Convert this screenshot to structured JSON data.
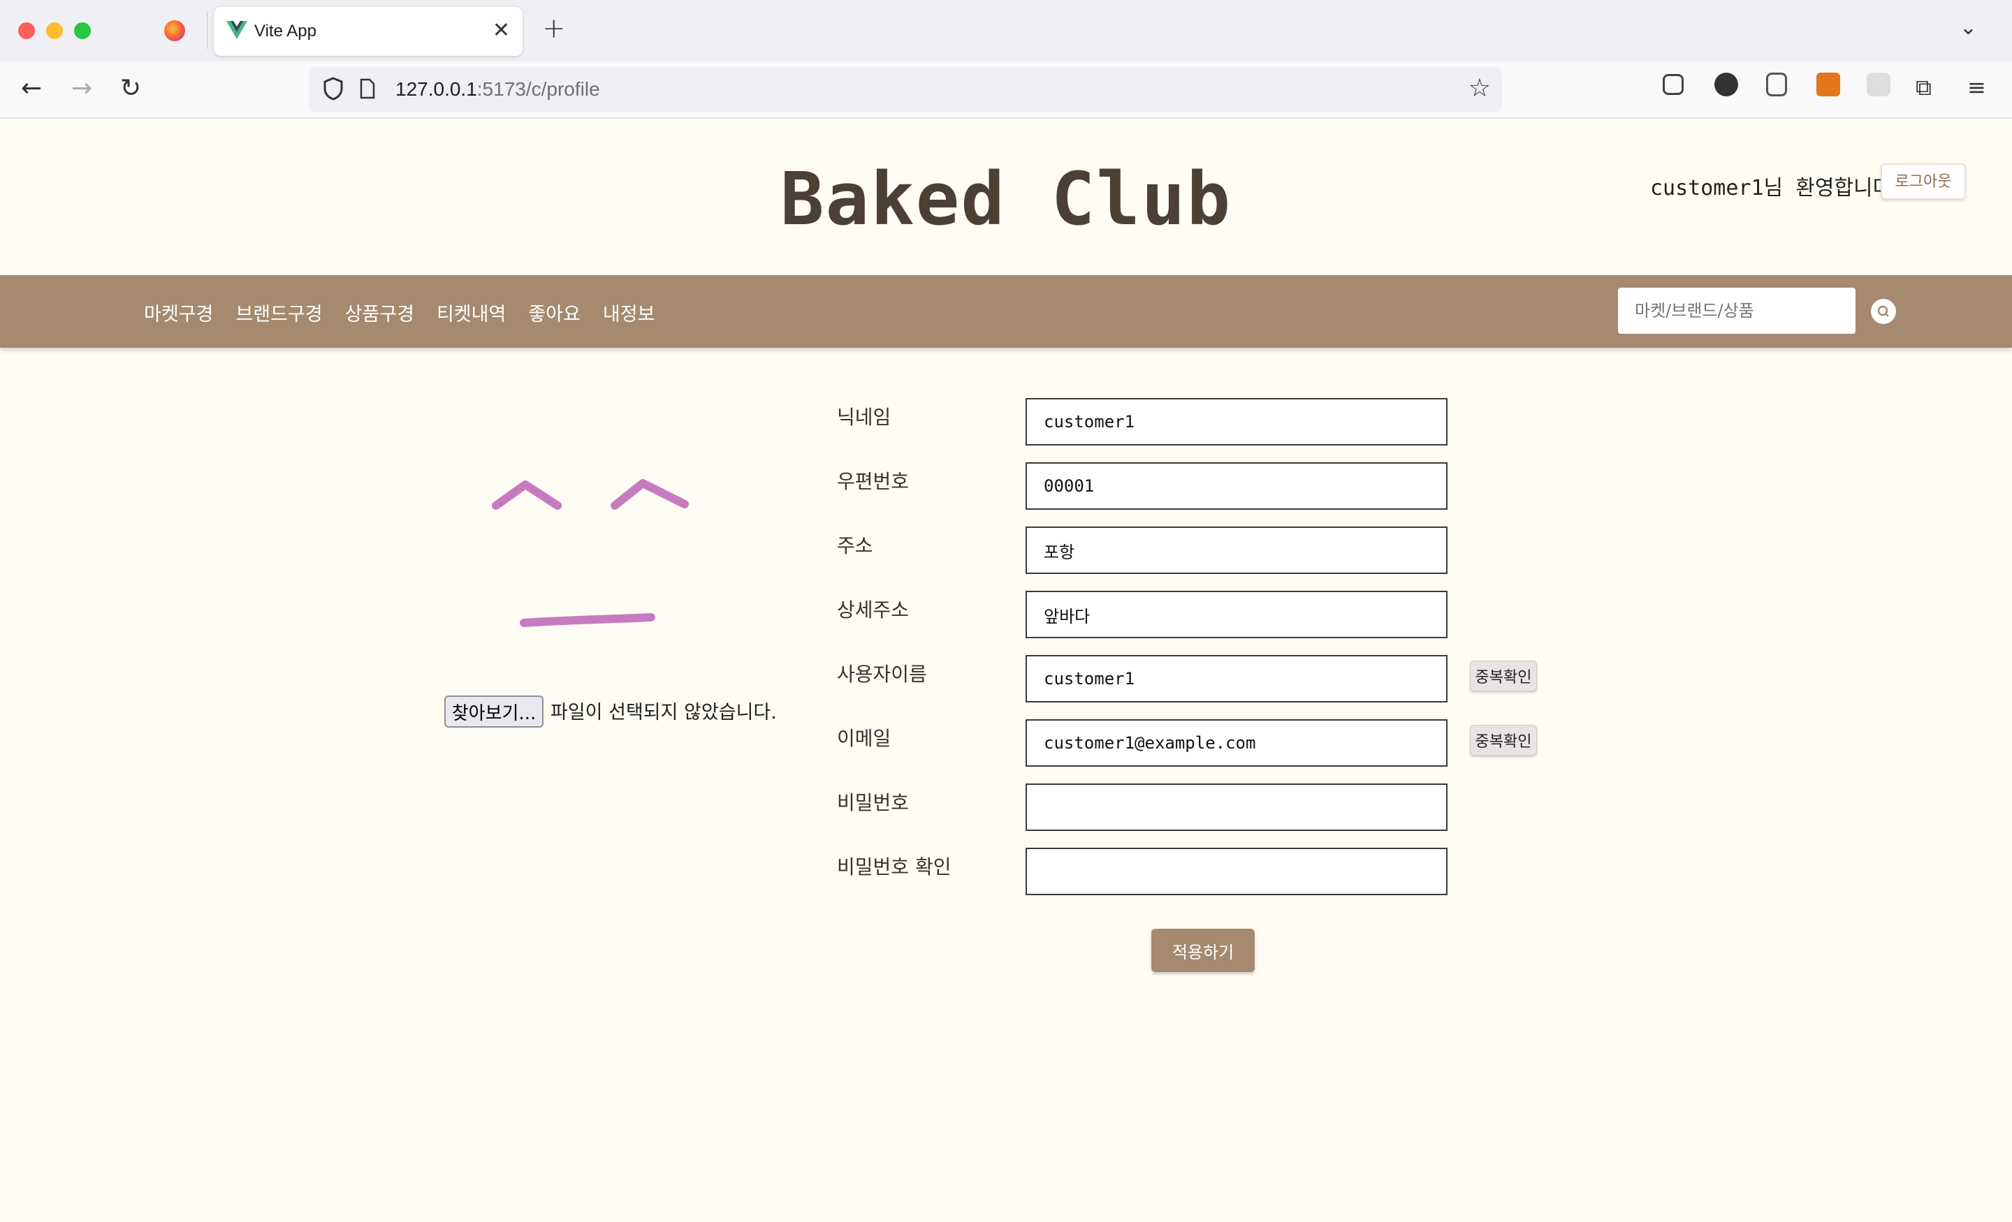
{
  "browser": {
    "tab_title": "Vite App",
    "url_host": "127.0.0.1",
    "url_rest": ":5173/c/profile"
  },
  "header": {
    "brand": "Baked Club",
    "welcome": "customer1님 환영합니다",
    "logout_label": "로그아웃"
  },
  "nav": {
    "items": [
      "마켓구경",
      "브랜드구경",
      "상품구경",
      "티켓내역",
      "좋아요",
      "내정보"
    ],
    "search_placeholder": "마켓/브랜드/상품"
  },
  "profile": {
    "file_button": "찾아보기...",
    "file_status": "파일이 선택되지 않았습니다."
  },
  "form": {
    "fields": [
      {
        "label": "닉네임",
        "value": "customer1"
      },
      {
        "label": "우편번호",
        "value": "00001"
      },
      {
        "label": "주소",
        "value": "포항"
      },
      {
        "label": "상세주소",
        "value": "앞바다"
      },
      {
        "label": "사용자이름",
        "value": "customer1"
      },
      {
        "label": "이메일",
        "value": "customer1@example.com"
      },
      {
        "label": "비밀번호",
        "value": ""
      },
      {
        "label": "비밀번호 확인",
        "value": ""
      }
    ],
    "dup_check_label": "중복확인",
    "apply_label": "적용하기"
  },
  "colors": {
    "accent": "#a58a6f",
    "brand_text": "#4c3f33",
    "background": "#fffcf3",
    "avatar_stroke": "#c77bbf"
  }
}
